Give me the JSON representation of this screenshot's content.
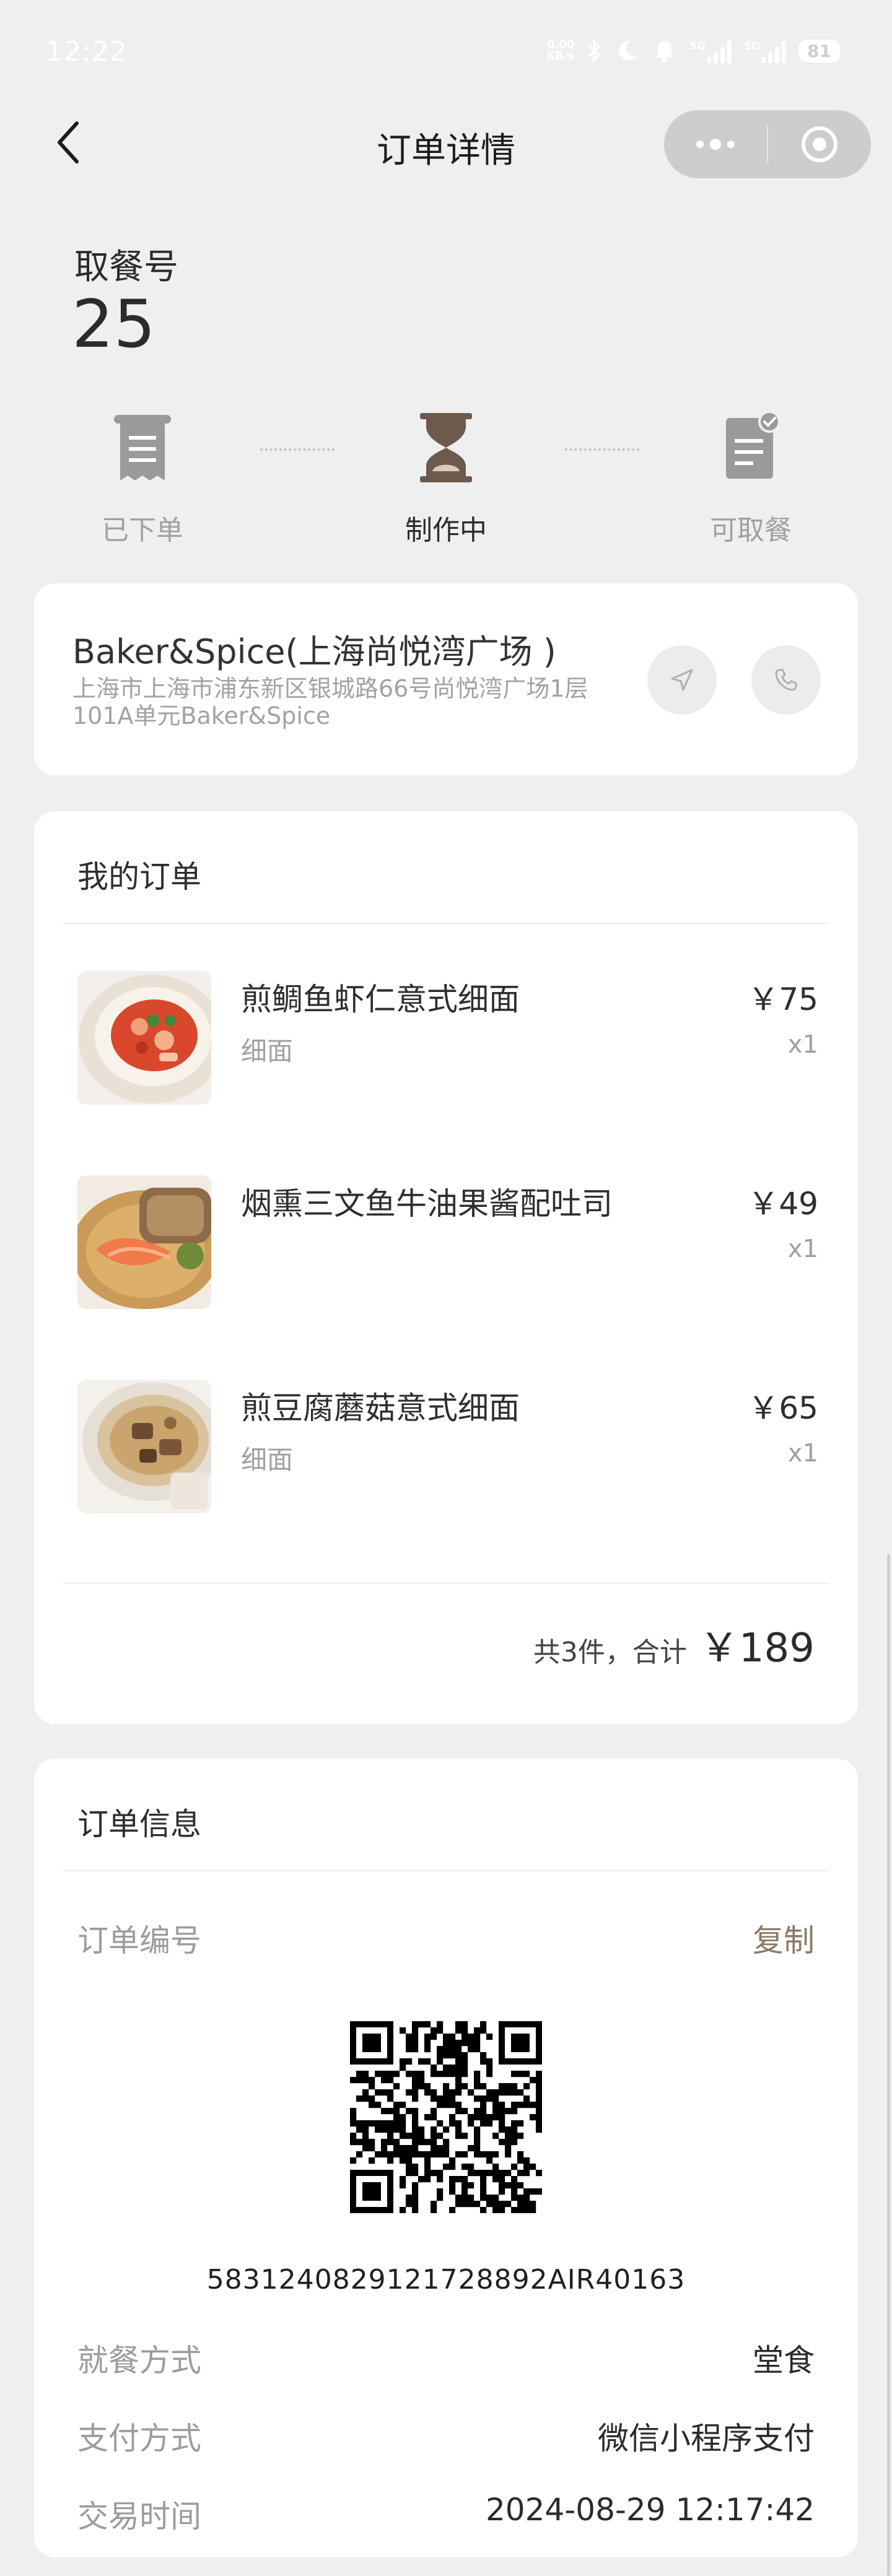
{
  "status_bar": {
    "time": "12:22",
    "net_speed_value": "0.00",
    "net_speed_unit": "KB/s",
    "network_1": "5G",
    "network_2": "5G",
    "battery": "81",
    "icons": [
      "bluetooth-icon",
      "moon-icon",
      "bell-icon"
    ]
  },
  "nav": {
    "title": "订单详情"
  },
  "pickup": {
    "label": "取餐号",
    "number": "25"
  },
  "progress": {
    "steps": [
      {
        "label": "已下单",
        "icon": "receipt-icon",
        "active": false
      },
      {
        "label": "制作中",
        "icon": "hourglass-icon",
        "active": true
      },
      {
        "label": "可取餐",
        "icon": "ready-doc-icon",
        "active": false
      }
    ]
  },
  "store": {
    "name": "Baker&Spice(上海尚悦湾广场 )",
    "address": "上海市上海市浦东新区银城路66号尚悦湾广场1层101A单元Baker&Spice"
  },
  "order": {
    "title": "我的订单",
    "items": [
      {
        "name": "煎鲷鱼虾仁意式细面",
        "spec": "细面",
        "price": "￥75",
        "qty": "x1"
      },
      {
        "name": "烟熏三文鱼牛油果酱配吐司",
        "spec": "",
        "price": "￥49",
        "qty": "x1"
      },
      {
        "name": "煎豆腐蘑菇意式细面",
        "spec": "细面",
        "price": "￥65",
        "qty": "x1"
      }
    ],
    "total_label": "共3件，合计",
    "total_amount": "￥189"
  },
  "order_info": {
    "title": "订单信息",
    "order_no_label": "订单编号",
    "copy_label": "复制",
    "order_no": "5831240829121728892AIR40163",
    "dining_label": "就餐方式",
    "dining_value": "堂食",
    "payment_label": "支付方式",
    "payment_value": "微信小程序支付",
    "time_label": "交易时间",
    "time_value": "2024-08-29 12:17:42"
  },
  "colors": {
    "background": "#efefef",
    "card": "#ffffff",
    "active_step": "#2b2b2b",
    "inactive_step": "#a0a0a0",
    "copy_accent": "#8a7a66"
  }
}
